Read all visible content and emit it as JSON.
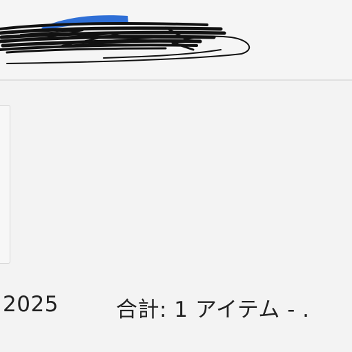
{
  "order": {
    "year": "2025",
    "total_items": "合計: 1 アイテム  -  ."
  },
  "colors": {
    "background": "#f3f3f3",
    "text": "#222222",
    "redaction_ink": "#111111",
    "redaction_blue": "#2f6fd6",
    "divider": "#e0e0e0"
  },
  "icons": {
    "redaction": "handwritten-scribble"
  }
}
